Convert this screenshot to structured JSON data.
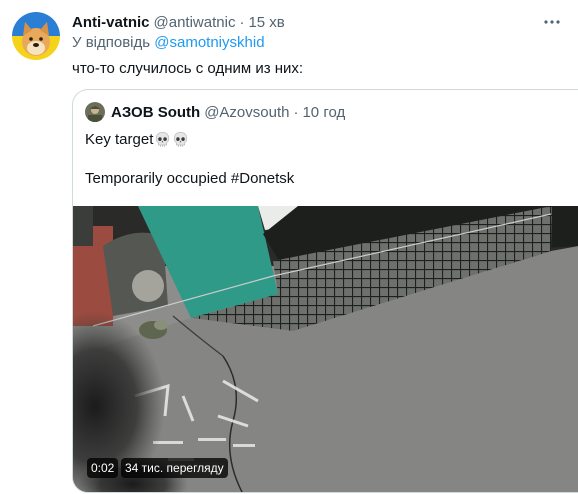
{
  "tweet": {
    "author": {
      "display_name": "Anti-vatnic",
      "handle": "@antiwatnic",
      "avatar_icon": "doge-avatar"
    },
    "separator": "·",
    "time": "15 хв",
    "reply": {
      "prefix": "У відповідь",
      "mention": "@samotniyskhid"
    },
    "text": "что-то случилось с одним из них:",
    "more_icon": "more-dots-icon"
  },
  "quoted_tweet": {
    "author": {
      "display_name": "АЗОВ South",
      "handle": "@Azovsouth",
      "avatar_icon": "soldier-avatar"
    },
    "separator": "·",
    "time": "10 год",
    "text_line1": "Key target",
    "emojis": [
      "skull-emoji",
      "skull-emoji"
    ],
    "text_line2": "Temporarily occupied #Donetsk",
    "media": {
      "type": "video",
      "duration": "0:02",
      "views": "34 тис. перегляду"
    }
  },
  "colors": {
    "link": "#1d9bf0",
    "secondary_text": "#536471",
    "primary_text": "#0f1419",
    "border": "#cfd9de"
  }
}
